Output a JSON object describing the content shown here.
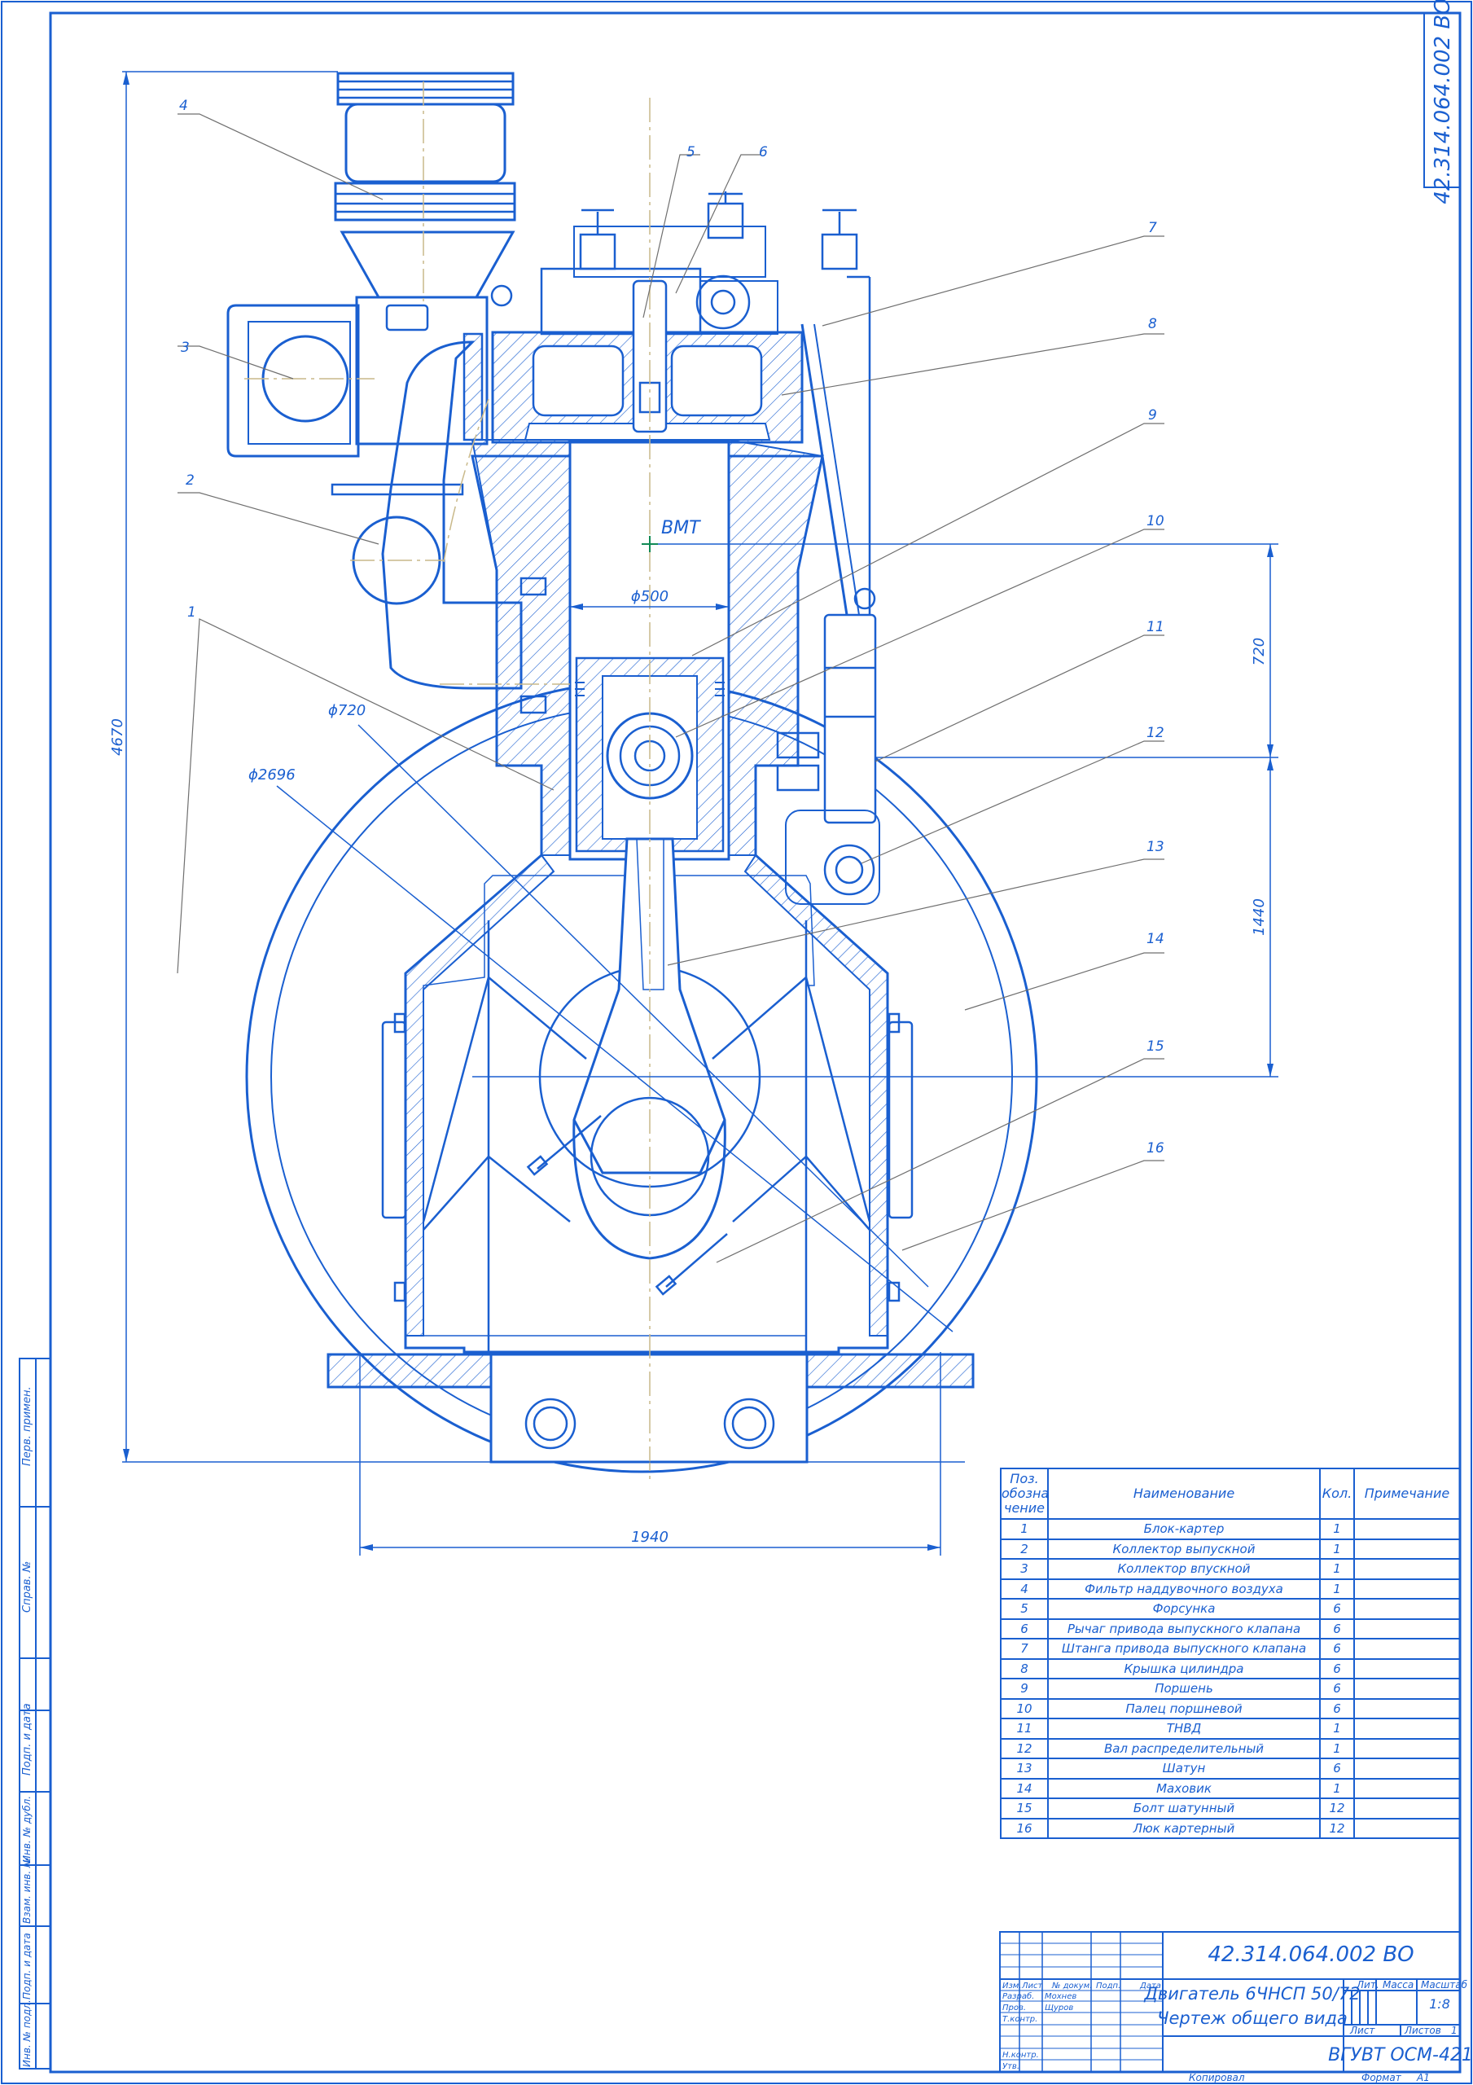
{
  "drawing": {
    "designation": "42.314.064.002 ВО",
    "designation_rotated": "42.314.064.002 ВО",
    "dims": {
      "height_total": "4670",
      "bore": "ϕ500",
      "d720": "ϕ720",
      "d2696": "ϕ2696",
      "stroke_720": "720",
      "dim_1440": "1440",
      "width_1940": "1940"
    },
    "bmt": "ВМТ",
    "callouts": [
      "1",
      "2",
      "3",
      "4",
      "5",
      "6",
      "7",
      "8",
      "9",
      "10",
      "11",
      "12",
      "13",
      "14",
      "15",
      "16"
    ],
    "colors": {
      "line": "#1a5fd0",
      "hatch": "#1a5fd0",
      "center": "#c9b98a"
    }
  },
  "spec": {
    "headers": {
      "pos": "Поз. обозна-чение",
      "name": "Наименование",
      "qty": "Кол.",
      "note": "Примечание"
    },
    "rows": [
      {
        "pos": "1",
        "name": "Блок-картер",
        "qty": "1"
      },
      {
        "pos": "2",
        "name": "Коллектор выпускной",
        "qty": "1"
      },
      {
        "pos": "3",
        "name": "Коллектор впускной",
        "qty": "1"
      },
      {
        "pos": "4",
        "name": "Фильтр наддувочного воздуха",
        "qty": "1"
      },
      {
        "pos": "5",
        "name": "Форсунка",
        "qty": "6"
      },
      {
        "pos": "6",
        "name": "Рычаг привода выпускного клапана",
        "qty": "6"
      },
      {
        "pos": "7",
        "name": "Штанга привода выпускного клапана",
        "qty": "6"
      },
      {
        "pos": "8",
        "name": "Крышка цилиндра",
        "qty": "6"
      },
      {
        "pos": "9",
        "name": "Поршень",
        "qty": "6"
      },
      {
        "pos": "10",
        "name": "Палец поршневой",
        "qty": "6"
      },
      {
        "pos": "11",
        "name": "ТНВД",
        "qty": "1"
      },
      {
        "pos": "12",
        "name": "Вал распределительный",
        "qty": "1"
      },
      {
        "pos": "13",
        "name": "Шатун",
        "qty": "6"
      },
      {
        "pos": "14",
        "name": "Маховик",
        "qty": "1"
      },
      {
        "pos": "15",
        "name": "Болт шатунный",
        "qty": "12"
      },
      {
        "pos": "16",
        "name": "Люк картерный",
        "qty": "12"
      }
    ]
  },
  "title_block": {
    "designation": "42.314.064.002 ВО",
    "title_line1": "Двигатель 6ЧНСП 50/72",
    "title_line2": "Чертеж общего вида",
    "lit": "Лит.",
    "mass": "Масса",
    "scale": "Масштаб",
    "scale_value": "1:8",
    "sheet": "Лист",
    "sheets": "Листов",
    "sheets_value": "1",
    "org": "ВГУВТ ОСМ-421",
    "cols": [
      "Изм.",
      "Лист",
      "№ докум.",
      "Подп.",
      "Дата"
    ],
    "roles": [
      {
        "role": "Разраб.",
        "name": "Мохнев"
      },
      {
        "role": "Пров.",
        "name": "Щуров"
      },
      {
        "role": "Т.контр.",
        "name": ""
      },
      {
        "role": "Н.контр.",
        "name": ""
      },
      {
        "role": "Утв.",
        "name": ""
      }
    ],
    "copied": "Копировал",
    "format": "Формат",
    "format_value": "А1"
  },
  "side_strip": [
    "Перв. примен.",
    "Справ. №",
    "Подп. и дата",
    "Инв. № дубл.",
    "Взам. инв. №",
    "Подп. и дата",
    "Инв. № подл."
  ]
}
